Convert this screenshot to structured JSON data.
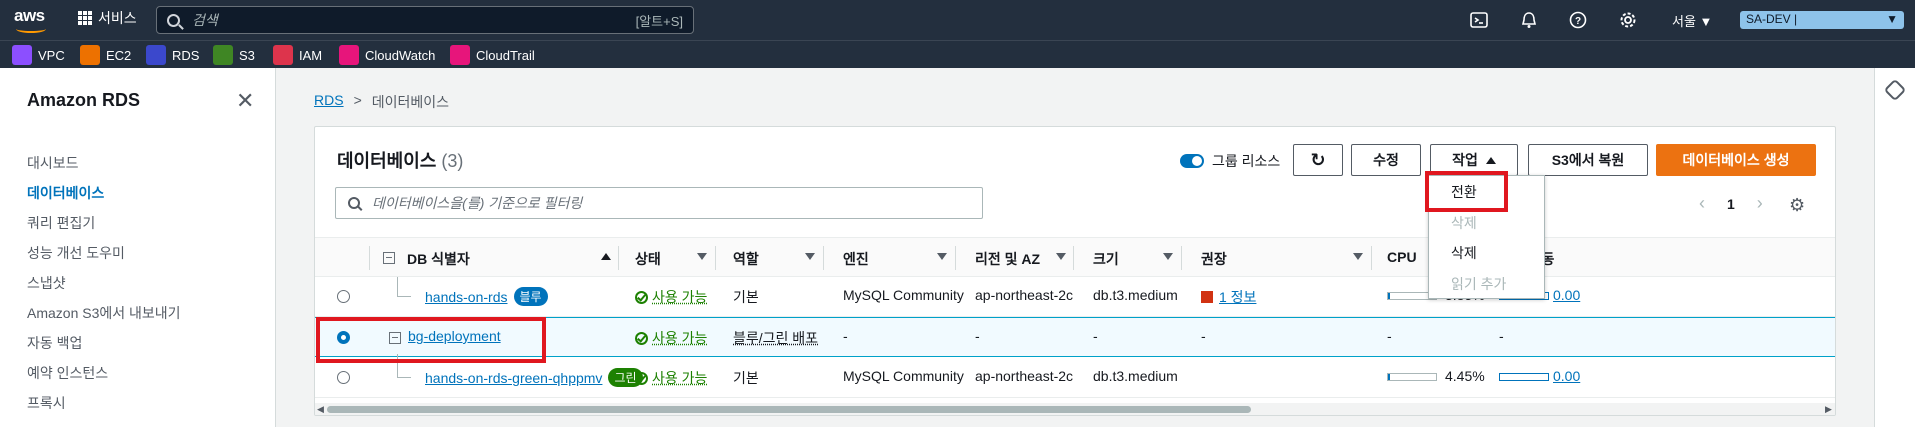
{
  "topbar": {
    "logo": "aws",
    "services_label": "서비스",
    "search_placeholder": "검색",
    "search_shortcut": "[알트+S]",
    "region": "서울 ▼",
    "account": "SA-DEV |",
    "icons": [
      "cloudshell-icon",
      "notifications-icon",
      "help-icon",
      "settings-icon"
    ]
  },
  "favorites": [
    {
      "label": "VPC",
      "color": "#8c4fff"
    },
    {
      "label": "EC2",
      "color": "#ed7100"
    },
    {
      "label": "RDS",
      "color": "#3b48cc"
    },
    {
      "label": "S3",
      "color": "#3f8624"
    },
    {
      "label": "IAM",
      "color": "#dd344c"
    },
    {
      "label": "CloudWatch",
      "color": "#e7157b"
    },
    {
      "label": "CloudTrail",
      "color": "#e7157b"
    }
  ],
  "sidebar": {
    "title": "Amazon RDS",
    "items": [
      {
        "label": "대시보드",
        "active": false
      },
      {
        "label": "데이터베이스",
        "active": true
      },
      {
        "label": "쿼리 편집기",
        "active": false
      },
      {
        "label": "성능 개선 도우미",
        "active": false
      },
      {
        "label": "스냅샷",
        "active": false
      },
      {
        "label": "Amazon S3에서 내보내기",
        "active": false
      },
      {
        "label": "자동 백업",
        "active": false
      },
      {
        "label": "예약 인스턴스",
        "active": false
      },
      {
        "label": "프록시",
        "active": false
      }
    ]
  },
  "breadcrumb": {
    "root": "RDS",
    "sep": ">",
    "current": "데이터베이스"
  },
  "panel": {
    "title": "데이터베이스",
    "count": "(3)",
    "group_toggle_label": "그룹 리소스",
    "buttons": {
      "refresh": "↻",
      "modify": "수정",
      "actions": "작업",
      "restore_s3": "S3에서 복원",
      "create": "데이터베이스 생성"
    },
    "filter_placeholder": "데이터베이스을(를) 기준으로 필터링",
    "pager": {
      "prev": "‹",
      "page": "1",
      "next": "›"
    }
  },
  "table": {
    "columns": [
      "DB 식별자",
      "상태",
      "역할",
      "엔진",
      "리전 및 AZ",
      "크기",
      "권장",
      "CPU",
      "현재 활동"
    ],
    "rows": [
      {
        "id": "hands-on-rds",
        "badge": "블루",
        "status": "사용 가능",
        "role": "기본",
        "engine": "MySQL Community",
        "region": "ap-northeast-2c",
        "size": "db.t3.medium",
        "recommend": "1 정보",
        "cpu": "3.85%",
        "cpu_pct": 3.85,
        "activity": "0.00"
      },
      {
        "id": "bg-deployment",
        "badge": "",
        "status": "사용 가능",
        "role": "블루/그린 배포",
        "engine": "-",
        "region": "-",
        "size": "-",
        "recommend": "-",
        "cpu": "-",
        "cpu_pct": 0,
        "activity": "-"
      },
      {
        "id": "hands-on-rds-green-qhppmv",
        "badge": "그린",
        "status": "사용 가능",
        "role": "기본",
        "engine": "MySQL Community",
        "region": "ap-northeast-2c",
        "size": "db.t3.medium",
        "recommend": "",
        "cpu": "4.45%",
        "cpu_pct": 4.45,
        "activity": "0.00"
      }
    ]
  },
  "actions_menu": {
    "items": [
      {
        "label": "전환",
        "disabled": false
      },
      {
        "label": "삭제",
        "disabled": true
      },
      {
        "label": "삭제",
        "disabled": false
      },
      {
        "label": "읽기 추가",
        "disabled": true
      }
    ]
  },
  "colors": {
    "accent": "#0073bb",
    "primary_button": "#ec7211",
    "highlight": "#e0171f",
    "nav": "#232f3e"
  }
}
